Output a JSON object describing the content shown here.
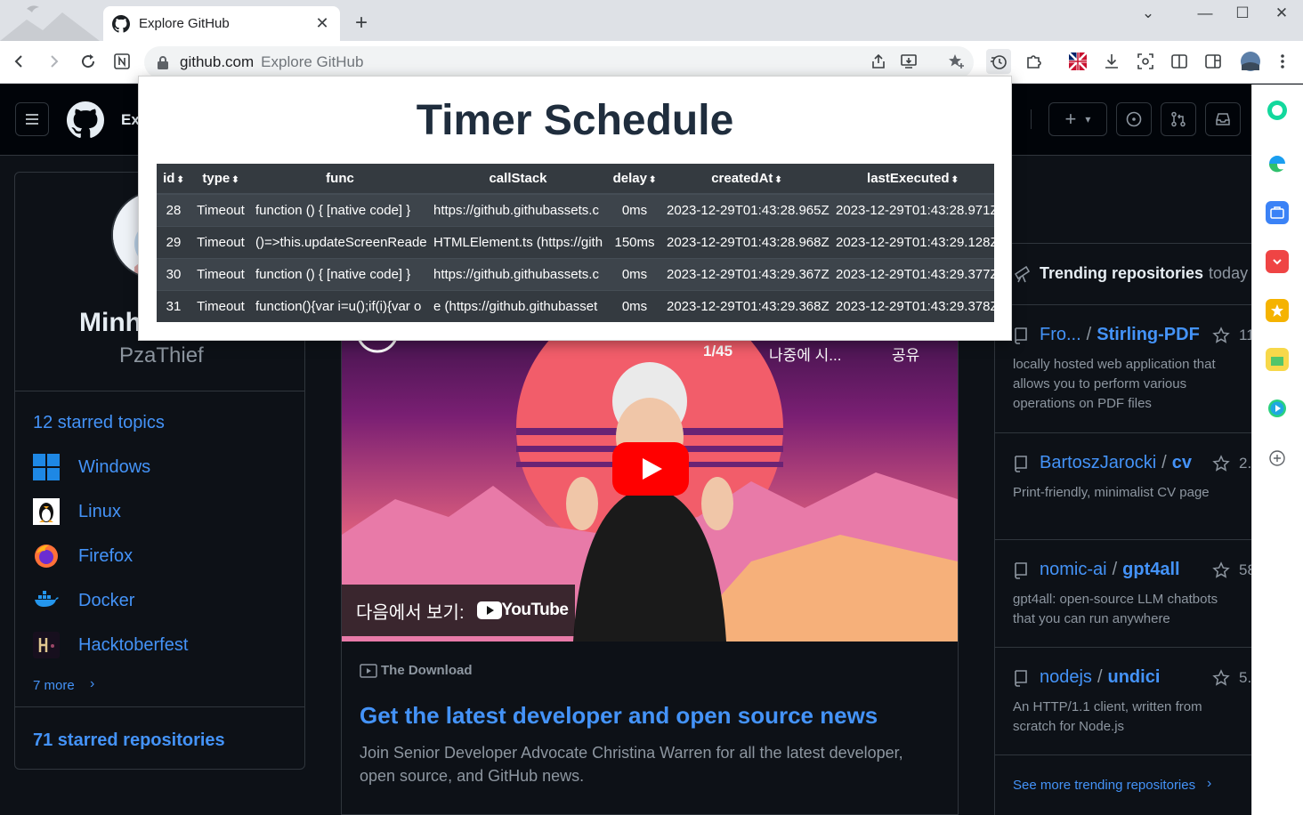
{
  "browser": {
    "tab_title": "Explore GitHub",
    "new_tab": "+",
    "close_tab": "✕",
    "window_controls": [
      "⌄",
      "—",
      "☐",
      "✕"
    ],
    "url_host": "github.com",
    "url_page_title": "Explore GitHub"
  },
  "gh_header": {
    "title_partial": "Ex",
    "create_label": "+",
    "create_caret": "▾"
  },
  "profile": {
    "name_partial": "Minh",
    "login": "PzaThief",
    "topics_title": "12 starred topics",
    "topics": [
      {
        "label": "Windows",
        "icon": "windows-logo-icon"
      },
      {
        "label": "Linux",
        "icon": "tux-icon"
      },
      {
        "label": "Firefox",
        "icon": "firefox-icon"
      },
      {
        "label": "Docker",
        "icon": "docker-icon"
      },
      {
        "label": "Hacktoberfest",
        "icon": "hacktoberfest-icon"
      }
    ],
    "more_link": "7 more",
    "more_chevron": "›",
    "starred_repos": "71 starred repositories"
  },
  "video": {
    "counter": "1/45",
    "watch_later": "나중에 시...",
    "share": "공유",
    "watch_on": "다음에서 보기:",
    "youtube_word": "YouTube"
  },
  "news": {
    "tag": "The Download",
    "title": "Get the latest developer and open source news",
    "body": "Join Senior Developer Advocate Christina Warren for all the latest developer, open source, and GitHub news."
  },
  "trending": {
    "label": "Trending repositories",
    "period": "today",
    "repos": [
      {
        "owner": "Fro...",
        "name": "Stirling-PDF",
        "stars": "11.",
        "desc": "locally hosted web application that allows you to perform various operations on PDF files"
      },
      {
        "owner": "BartoszJarocki",
        "name": "cv",
        "stars": "2.",
        "desc": "Print-friendly, minimalist CV page"
      },
      {
        "owner": "nomic-ai",
        "name": "gpt4all",
        "stars": "58.",
        "desc": "gpt4all: open-source LLM chatbots that you can run anywhere"
      },
      {
        "owner": "nodejs",
        "name": "undici",
        "stars": "5.",
        "desc": "An HTTP/1.1 client, written from scratch for Node.js"
      }
    ],
    "see_more": "See more trending repositories",
    "see_more_chevron": "›"
  },
  "popup": {
    "title": "Timer Schedule",
    "columns": [
      "id",
      "type",
      "func",
      "callStack",
      "delay",
      "createdAt",
      "lastExecuted"
    ],
    "sortable": [
      true,
      true,
      false,
      false,
      true,
      true,
      true
    ],
    "sort_glyph": "⬍",
    "rows": [
      {
        "id": "28",
        "type": "Timeout",
        "func": "function () { [native code] }",
        "callStack": "https://github.githubassets.c",
        "delay": "0ms",
        "createdAt": "2023-12-29T01:43:28.965Z",
        "lastExecuted": "2023-12-29T01:43:28.971Z"
      },
      {
        "id": "29",
        "type": "Timeout",
        "func": "()=>this.updateScreenReade",
        "callStack": "HTMLElement.ts (https://gith",
        "delay": "150ms",
        "createdAt": "2023-12-29T01:43:28.968Z",
        "lastExecuted": "2023-12-29T01:43:29.128Z"
      },
      {
        "id": "30",
        "type": "Timeout",
        "func": "function () { [native code] }",
        "callStack": "https://github.githubassets.c",
        "delay": "0ms",
        "createdAt": "2023-12-29T01:43:29.367Z",
        "lastExecuted": "2023-12-29T01:43:29.377Z"
      },
      {
        "id": "31",
        "type": "Timeout",
        "func": "function(){var i=u();if(i){var o",
        "callStack": "e (https://github.githubasset",
        "delay": "0ms",
        "createdAt": "2023-12-29T01:43:29.368Z",
        "lastExecuted": "2023-12-29T01:43:29.378Z"
      }
    ]
  },
  "colors": {
    "gh_bg": "#0d1117",
    "link": "#4493f8",
    "muted": "#8d96a0",
    "table_header": "#343a40",
    "youtube_red": "#ff0000"
  }
}
